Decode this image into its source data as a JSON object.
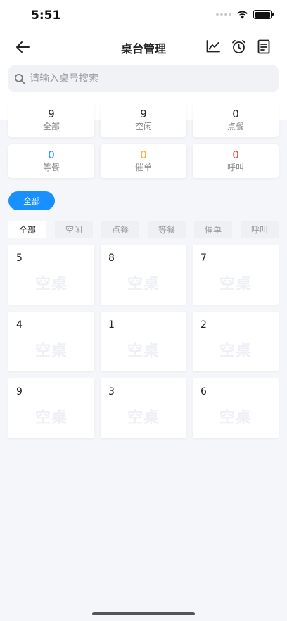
{
  "status_bar": {
    "time": "5:51"
  },
  "header": {
    "title": "桌台管理"
  },
  "search": {
    "placeholder": "请输入桌号搜索",
    "value": ""
  },
  "stats": [
    {
      "count": "9",
      "label": "全部",
      "color": "#222222"
    },
    {
      "count": "9",
      "label": "空闲",
      "color": "#222222"
    },
    {
      "count": "0",
      "label": "点餐",
      "color": "#222222"
    },
    {
      "count": "0",
      "label": "等餐",
      "color": "#1890ff"
    },
    {
      "count": "0",
      "label": "催单",
      "color": "#f5a623"
    },
    {
      "count": "0",
      "label": "呼叫",
      "color": "#e0443a"
    }
  ],
  "area_filter": {
    "label": "全部",
    "color": "#1890ff"
  },
  "status_tabs": [
    {
      "label": "全部",
      "active": true
    },
    {
      "label": "空闲",
      "active": false
    },
    {
      "label": "点餐",
      "active": false
    },
    {
      "label": "等餐",
      "active": false
    },
    {
      "label": "催单",
      "active": false
    },
    {
      "label": "呼叫",
      "active": false
    }
  ],
  "tables": [
    {
      "number": "5",
      "status": "空桌"
    },
    {
      "number": "8",
      "status": "空桌"
    },
    {
      "number": "7",
      "status": "空桌"
    },
    {
      "number": "4",
      "status": "空桌"
    },
    {
      "number": "1",
      "status": "空桌"
    },
    {
      "number": "2",
      "status": "空桌"
    },
    {
      "number": "9",
      "status": "空桌"
    },
    {
      "number": "3",
      "status": "空桌"
    },
    {
      "number": "6",
      "status": "空桌"
    }
  ],
  "icons": {
    "back": "arrow-left-icon",
    "chart": "line-chart-icon",
    "alarm": "alarm-clock-icon",
    "orders": "document-list-icon",
    "search": "search-icon"
  }
}
